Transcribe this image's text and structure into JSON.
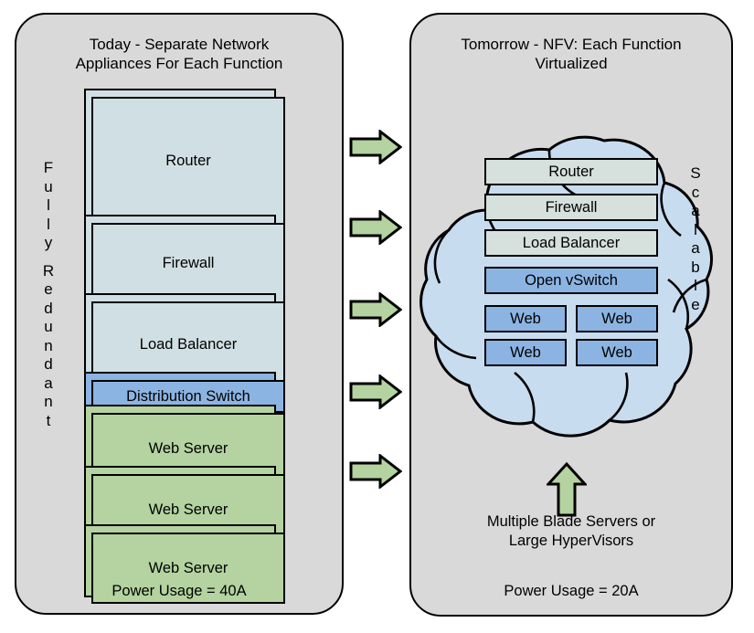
{
  "diagram": {
    "title_left": "Today - Separate Network Appliances For Each Function",
    "title_right": "Tomorrow - NFV: Each Function Virtualized"
  },
  "left_panel": {
    "title_line1": "Today - Separate Network",
    "title_line2": "Appliances For Each Function",
    "side_label": "Fully Redundant",
    "side_label_letters": [
      "F",
      "u",
      "l",
      "l",
      "y",
      "",
      "R",
      "e",
      "d",
      "u",
      "n",
      "d",
      "a",
      "n",
      "t"
    ],
    "appliances": [
      {
        "label": "Router",
        "color": "#d0dfe3",
        "kind": "network"
      },
      {
        "label": "Firewall",
        "color": "#d0dfe3",
        "kind": "network"
      },
      {
        "label": "Load Balancer",
        "color": "#d0dfe3",
        "kind": "network"
      },
      {
        "label": "Distribution Switch",
        "color": "#8cb4e2",
        "kind": "switch"
      },
      {
        "label": "Web Server",
        "color": "#b4d3a0",
        "kind": "server"
      },
      {
        "label": "Web Server",
        "color": "#b4d3a0",
        "kind": "server"
      },
      {
        "label": "Web Server",
        "color": "#b4d3a0",
        "kind": "server"
      }
    ],
    "power_usage": "Power Usage = 40A"
  },
  "arrows": {
    "count": 5,
    "color": "#b4d3a0",
    "direction": "right"
  },
  "right_panel": {
    "title_line1": "Tomorrow - NFV: Each Function",
    "title_line2": "Virtualized",
    "side_label": "Scalable",
    "side_label_letters": [
      "S",
      "c",
      "a",
      "l",
      "a",
      "b",
      "l",
      "e"
    ],
    "cloud_color": "#c8dcf0",
    "functions": [
      {
        "label": "Router",
        "color": "#d6e0dd"
      },
      {
        "label": "Firewall",
        "color": "#d6e0dd"
      },
      {
        "label": "Load Balancer",
        "color": "#d6e0dd"
      },
      {
        "label": "Open vSwitch",
        "color": "#8cb4e2"
      }
    ],
    "web_nodes": [
      {
        "label": "Web",
        "color": "#8cb4e2"
      },
      {
        "label": "Web",
        "color": "#8cb4e2"
      },
      {
        "label": "Web",
        "color": "#8cb4e2"
      },
      {
        "label": "Web",
        "color": "#8cb4e2"
      }
    ],
    "infrastructure_caption_line1": "Multiple Blade Servers or",
    "infrastructure_caption_line2": "Large HyperVisors",
    "up_arrow_color": "#b4d3a0",
    "power_usage": "Power Usage = 20A"
  }
}
